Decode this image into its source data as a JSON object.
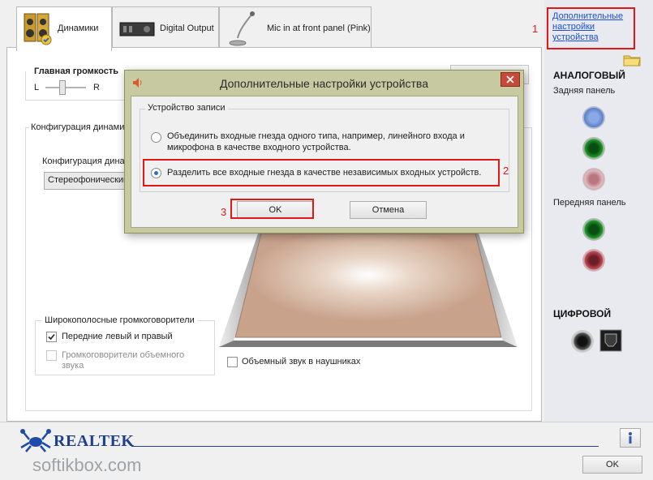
{
  "tabs": [
    {
      "label": "Динамики",
      "icon": "speakers-icon"
    },
    {
      "label": "Digital Output",
      "icon": "digital-output-device-icon"
    },
    {
      "label": "Mic in at front panel (Pink)",
      "icon": "microphone-icon"
    }
  ],
  "volume": {
    "title": "Главная громкость",
    "left": "L",
    "right": "R"
  },
  "speaker_config": {
    "group_title": "Конфигурация динами",
    "label": "Конфигурация дина",
    "select_value": "Стереофонический"
  },
  "wideband": {
    "title": "Широкополосные громкоговорители",
    "front": {
      "label": "Передние левый и правый",
      "checked": true
    },
    "surround": {
      "label": "Громкоговорители объемного звука",
      "checked": false,
      "disabled": true
    }
  },
  "headphones_surround": {
    "label": "Объемный звук в наушниках",
    "checked": false
  },
  "dialog": {
    "title": "Дополнительные настройки устройства",
    "group_title": "Устройство записи",
    "option1": "Объединить входные гнезда одного типа, например, линейного входа и микрофона в качестве входного устройства.",
    "option2": "Разделить все входные гнезда в качестве независимых входных устройств.",
    "selected": 2,
    "ok": "OK",
    "cancel": "Отмена"
  },
  "right_panel": {
    "link": "Дополнительные настройки устройства",
    "analog_title": "АНАЛОГОВЫЙ",
    "rear_panel": "Задняя панель",
    "front_panel": "Передняя панель",
    "digital_title": "ЦИФРОВОЙ",
    "jack_colors": {
      "blue": "#5b7fc9",
      "green": "#1f9a2a",
      "pink": "#d58c95",
      "red": "#c84a57"
    }
  },
  "annotations": [
    "1",
    "2",
    "3"
  ],
  "footer": {
    "brand": "REALTEK",
    "ok": "OK",
    "watermark": "softikbox.com"
  }
}
